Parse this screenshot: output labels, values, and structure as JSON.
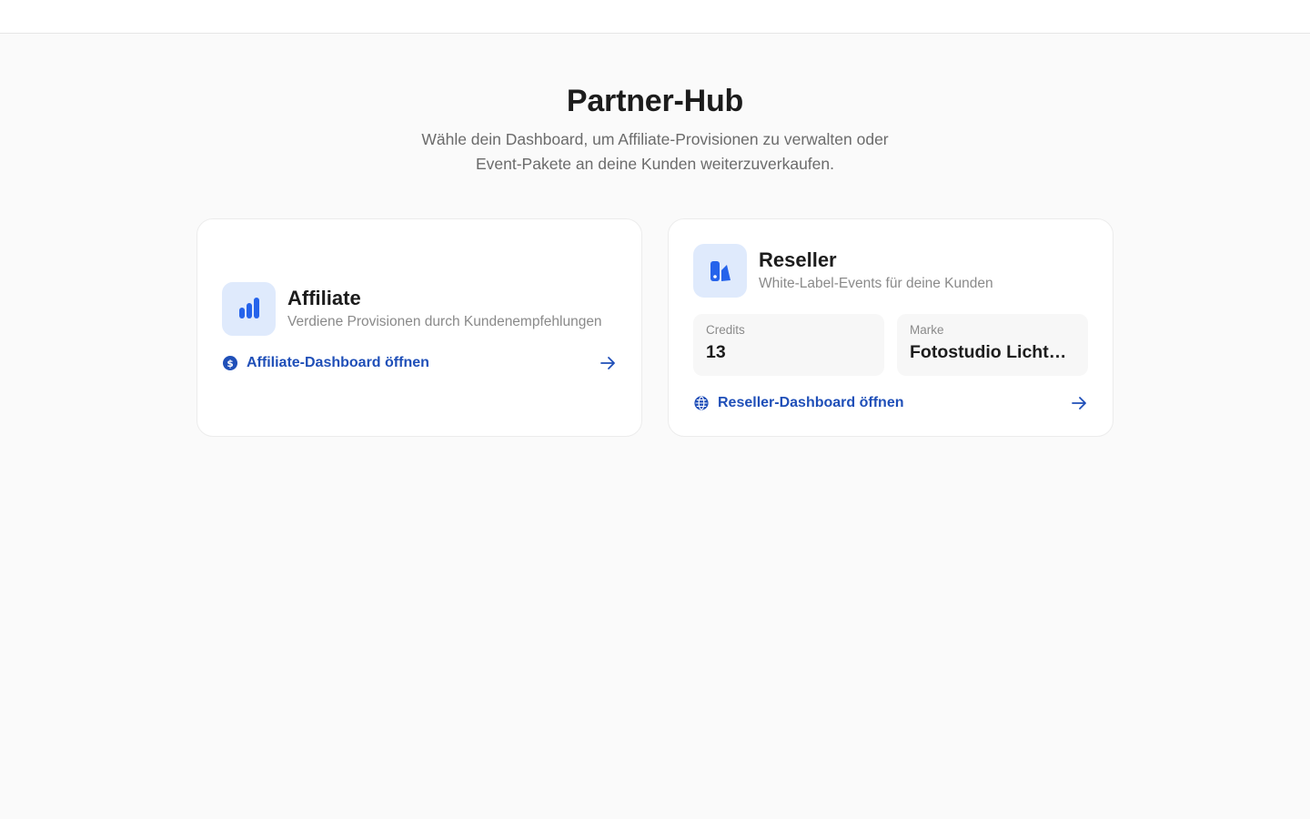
{
  "hero": {
    "title": "Partner-Hub",
    "subtitle": "Wähle dein Dashboard, um Affiliate-Provisionen zu verwalten oder Event-Pakete an deine Kunden weiterzuverkaufen."
  },
  "affiliate": {
    "title": "Affiliate",
    "subtitle": "Verdiene Provisionen durch Kundenempfehlungen",
    "icon": "bar-chart-icon",
    "link_label": "Affiliate-Dashboard öffnen",
    "link_icon": "dollar-circle-icon"
  },
  "reseller": {
    "title": "Reseller",
    "subtitle": "White-Label-Events für deine Kunden",
    "icon": "swatchbook-icon",
    "stats": [
      {
        "label": "Credits",
        "value": "13"
      },
      {
        "label": "Marke",
        "value": "Fotostudio Lichtblick"
      }
    ],
    "link_label": "Reseller-Dashboard öffnen",
    "link_icon": "globe-icon"
  },
  "colors": {
    "accent": "#1f4fb8",
    "icon_blue": "#2563eb",
    "icon_tile": "#dfeafc"
  }
}
